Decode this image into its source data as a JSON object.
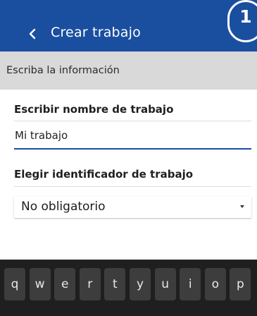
{
  "app_bar": {
    "title": "Crear trabajo",
    "back_icon": "chevron-left-icon",
    "step_number": "1",
    "background": "#1a4fa0"
  },
  "section": {
    "header": "Escriba la información"
  },
  "job_name": {
    "label": "Escribir nombre de trabajo",
    "value": "Mi trabajo",
    "underline_color": "#1a4fa0"
  },
  "job_id": {
    "label": "Elegir identificador de trabajo",
    "selected": "No obligatorio",
    "dropdown_icon": "caret-down-icon"
  },
  "keyboard": {
    "keys": [
      "q",
      "w",
      "e",
      "r",
      "t",
      "y",
      "u",
      "i",
      "o",
      "p"
    ]
  }
}
